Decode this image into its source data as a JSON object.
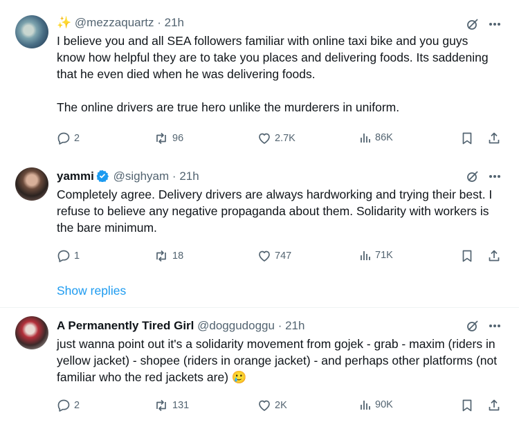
{
  "tweets": [
    {
      "name": "",
      "handle": "@mezzaquartz",
      "time": "21h",
      "sparkle": "✨",
      "paragraphs": [
        "I believe you and all SEA followers familiar with online taxi bike and you guys know how helpful they are to take you places and delivering foods. Its saddening that he even died when he was delivering foods.",
        "The online drivers are true hero unlike the murderers in uniform."
      ],
      "replies": "2",
      "reposts": "96",
      "likes": "2.7K",
      "views": "86K"
    },
    {
      "name": "yammi",
      "verified": true,
      "handle": "@sighyam",
      "time": "21h",
      "paragraphs": [
        "Completely agree. Delivery drivers are always hardworking and trying their best. I refuse to believe any negative propaganda about them. Solidarity with workers is the bare minimum."
      ],
      "replies": "1",
      "reposts": "18",
      "likes": "747",
      "views": "71K"
    },
    {
      "name": "A Permanently Tired Girl",
      "handle": "@doggudoggu",
      "time": "21h",
      "paragraphs": [
        "just wanna point out it's a solidarity movement from gojek - grab - maxim (riders in yellow jacket) - shopee (riders in orange jacket) - and perhaps other platforms (not familiar who the red jackets are) 🥲"
      ],
      "replies": "2",
      "reposts": "131",
      "likes": "2K",
      "views": "90K"
    }
  ],
  "show_replies": "Show replies",
  "separator": "·",
  "colors": {
    "accent": "#1d9bf0",
    "muted": "#536471",
    "text": "#0f1419",
    "divider": "#eff3f4"
  }
}
